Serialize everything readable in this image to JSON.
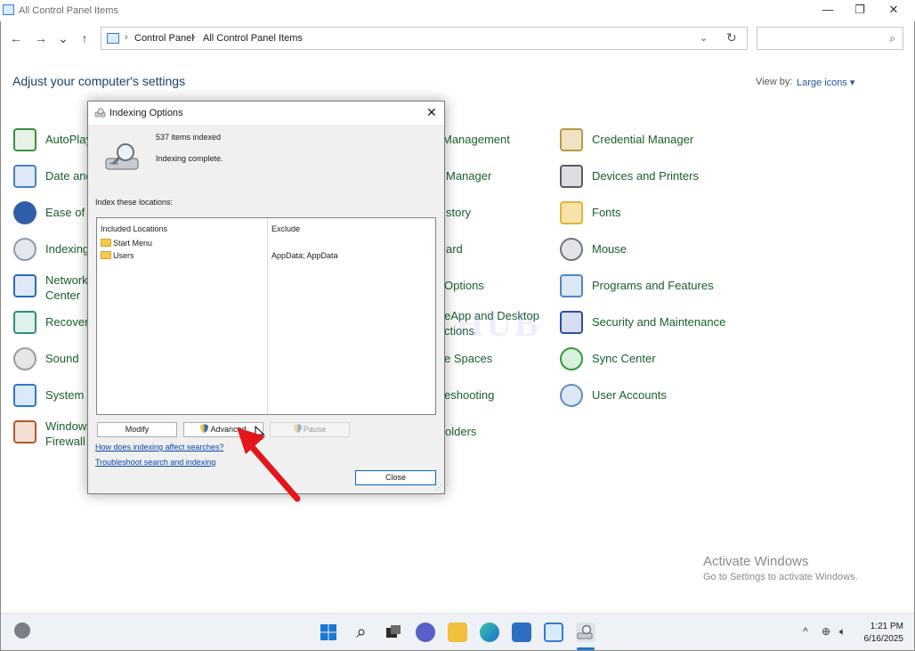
{
  "window": {
    "title": "All Control Panel Items",
    "minimize": "—",
    "maximize": "❐",
    "close": "✕"
  },
  "nav": {
    "back": "←",
    "forward": "→",
    "recent": "⌄",
    "up": "↑"
  },
  "address": {
    "crumbs": [
      "Control Panel",
      "All Control Panel Items"
    ],
    "separator": "›",
    "dropdown": "⌄",
    "refresh": "↻"
  },
  "search": {
    "placeholder": "",
    "icon": "⌕"
  },
  "header": {
    "title": "Adjust your computer's settings",
    "view_by_label": "View by:",
    "view_by_value": "Large icons ▾"
  },
  "items_left": [
    {
      "label": "AutoPlay",
      "icon": "autoplay-icon",
      "color": "#3b8f3b"
    },
    {
      "label": "Date and",
      "icon": "calendar-icon",
      "color": "#4a7fc7"
    },
    {
      "label": "Ease of A",
      "icon": "ease-of-access-icon",
      "color": "#2f5fa8"
    },
    {
      "label": "Indexing",
      "icon": "magnifier-drive-icon",
      "color": "#8a9bb0"
    },
    {
      "label_line1": "Network",
      "label_line2": "Center",
      "icon": "network-icon",
      "color": "#2e6bb5"
    },
    {
      "label": "Recovery",
      "icon": "recovery-icon",
      "color": "#2f8f7a"
    },
    {
      "label": "Sound",
      "icon": "speaker-icon",
      "color": "#9c9c9c"
    },
    {
      "label": "System",
      "icon": "computer-icon",
      "color": "#2f78c4"
    },
    {
      "label_line1": "Windows",
      "label_line2": "Firewall",
      "icon": "firewall-icon",
      "color": "#b5562f"
    }
  ],
  "items_mid": [
    {
      "label": "Management"
    },
    {
      "label": "Manager"
    },
    {
      "label": "story"
    },
    {
      "label": "ard"
    },
    {
      "label": "Options"
    },
    {
      "label_line1": "eApp and Desktop",
      "label_line2": "ctions"
    },
    {
      "label": "e Spaces"
    },
    {
      "label": "eshooting"
    },
    {
      "label": "olders"
    }
  ],
  "items_right": [
    {
      "label": "Credential Manager",
      "icon": "credential-safe-icon",
      "color": "#b99a4a"
    },
    {
      "label": "Devices and Printers",
      "icon": "printer-icon",
      "color": "#555b66"
    },
    {
      "label": "Fonts",
      "icon": "fonts-folder-icon",
      "color": "#e2b33c"
    },
    {
      "label": "Mouse",
      "icon": "mouse-icon",
      "color": "#6f7680"
    },
    {
      "label": "Programs and Features",
      "icon": "programs-icon",
      "color": "#4a86c8"
    },
    {
      "label": "Security and Maintenance",
      "icon": "flag-icon",
      "color": "#2c4fa3"
    },
    {
      "label": "Sync Center",
      "icon": "sync-icon",
      "color": "#2e9a3f"
    },
    {
      "label": "User Accounts",
      "icon": "users-icon",
      "color": "#5f8fbf"
    }
  ],
  "dialog": {
    "title": "Indexing Options",
    "close": "✕",
    "items_indexed": "537 items indexed",
    "status": "Indexing complete.",
    "section_label": "Index these locations:",
    "col_included": "Included Locations",
    "col_exclude": "Exclude",
    "rows": [
      {
        "name": "Start Menu",
        "exclude": ""
      },
      {
        "name": "Users",
        "exclude": "AppData; AppData"
      }
    ],
    "btn_modify": "Modify",
    "btn_advanced": "Advanced",
    "btn_pause": "Pause",
    "link_how": "How does indexing affect searches?",
    "link_troubleshoot": "Troubleshoot search and indexing",
    "btn_close": "Close"
  },
  "watermark": "IT Pro HUB",
  "activation": {
    "line1": "Activate Windows",
    "line2": "Go to Settings to activate Windows."
  },
  "taskbar": {
    "time": "1:21 PM",
    "date": "6/16/2025",
    "tray_up": "^",
    "tray_network": "⊕",
    "tray_volume": "🔈︎"
  },
  "colors": {
    "link": "#1a5d2c",
    "accent": "#0067c0",
    "arrow": "#e3161b"
  }
}
